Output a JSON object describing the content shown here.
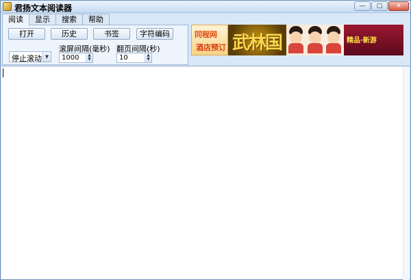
{
  "window": {
    "title": "君扬文本阅读器",
    "controls": {
      "minimize": "—",
      "maximize": "□",
      "close": "✕"
    }
  },
  "tabs": [
    {
      "label": "阅读",
      "active": true
    },
    {
      "label": "显示",
      "active": false
    },
    {
      "label": "搜索",
      "active": false
    },
    {
      "label": "帮助",
      "active": false
    }
  ],
  "reading_panel": {
    "buttons": {
      "open": "打开",
      "history": "历史",
      "bookmark": "书签",
      "encoding": "字符编码"
    },
    "scroll_mode": {
      "selected": "停止滚动"
    },
    "scroll_interval": {
      "label": "滚屏间隔(毫秒)",
      "value": "1000"
    },
    "page_interval": {
      "label": "翻页间隔(秒)",
      "value": "10"
    }
  },
  "ad_banner": {
    "segment1_line1": "同程网",
    "segment1_line2": "酒店预订",
    "segment2_text": "武林国",
    "segment4_text": "精品·新游"
  },
  "content": {
    "text": ""
  }
}
